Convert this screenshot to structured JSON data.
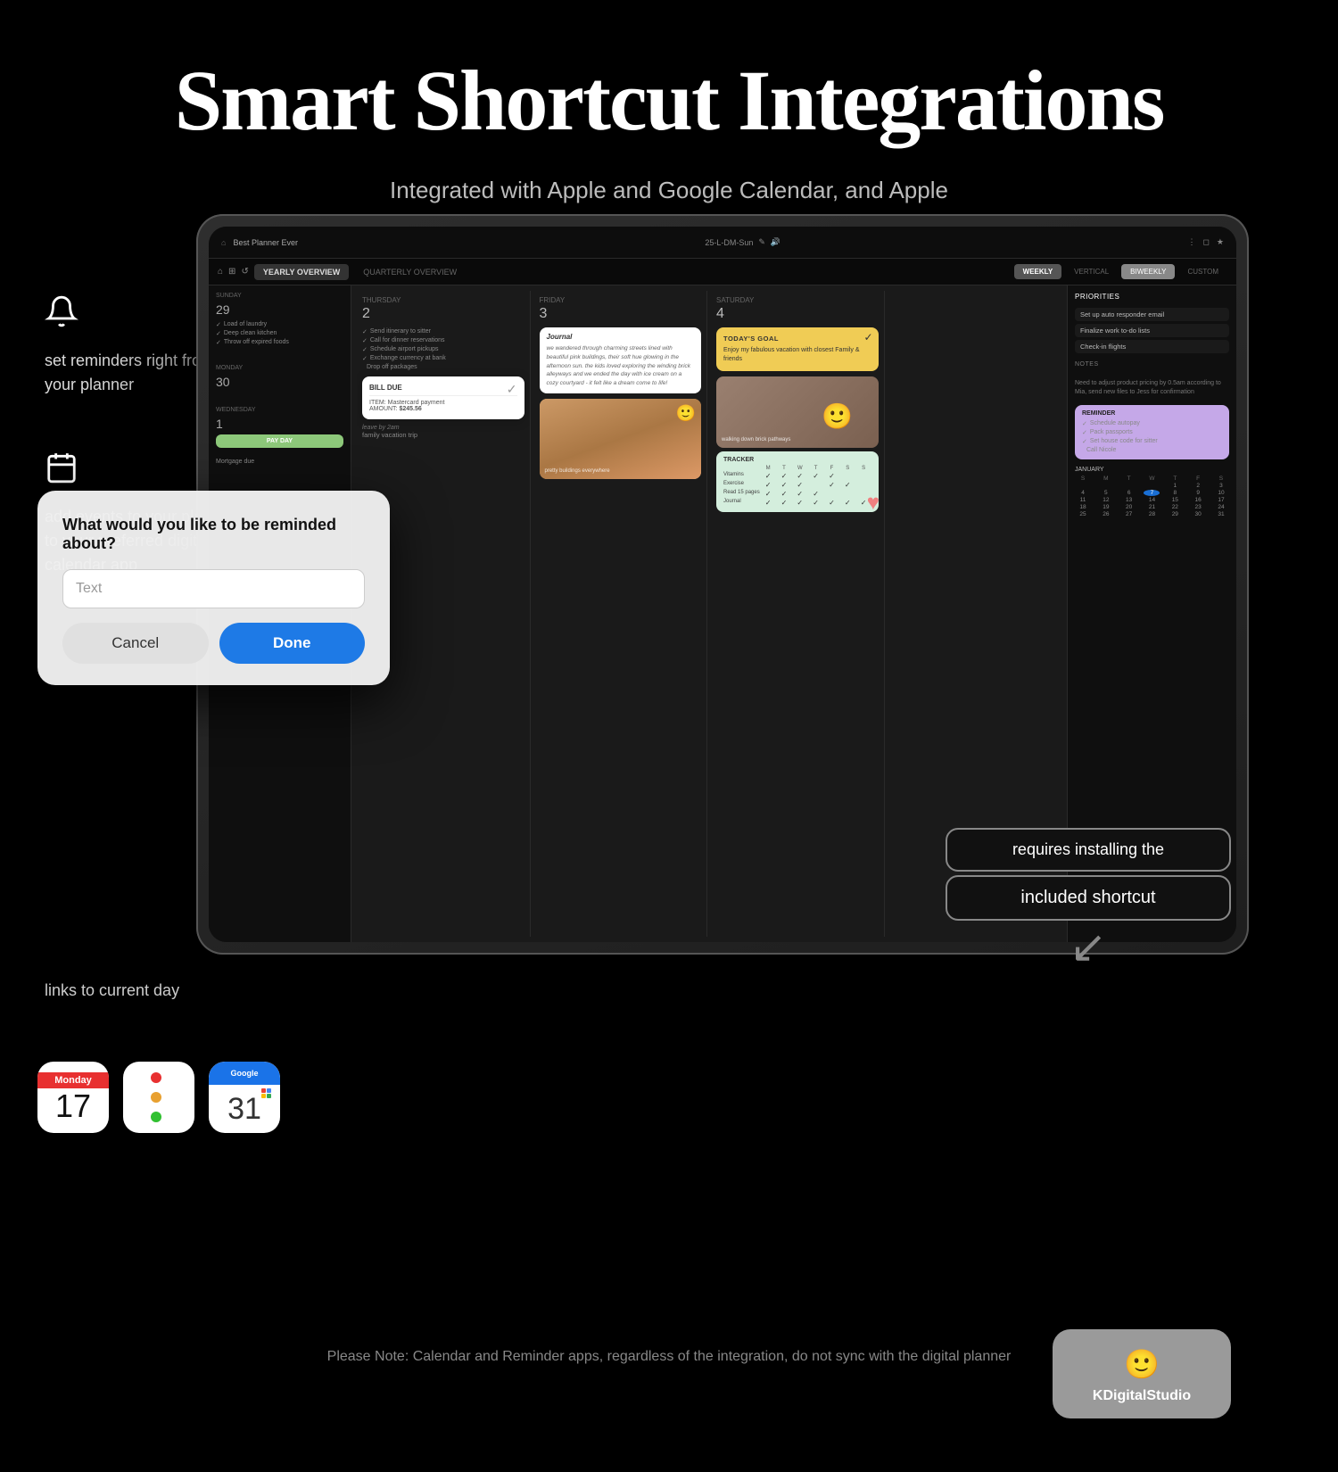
{
  "page": {
    "title": "Smart Shortcut Integrations",
    "subtitle": "Integrated with Apple and Google Calendar, and Apple Reminders\nusing Shortcuts on iPad"
  },
  "features": [
    {
      "id": "reminders",
      "icon": "bell",
      "text": "set reminders right from your planner"
    },
    {
      "id": "calendar",
      "icon": "calendar",
      "text": "add events to your planner to your preferred digital calendar app"
    },
    {
      "id": "today",
      "icon": "link",
      "text": "links to current day"
    }
  ],
  "dialog": {
    "title": "What would you like to be reminded about?",
    "placeholder": "Text",
    "cancel_label": "Cancel",
    "done_label": "Done"
  },
  "planner": {
    "nav_tabs": [
      "YEARLY OVERVIEW",
      "QUARTERLY OVERVIEW"
    ],
    "view_tabs": [
      "WEEKLY",
      "VERTICAL",
      "BIWEEKLY",
      "CUSTOM"
    ],
    "top_bar_left": "Best Planner Ever",
    "top_bar_date": "25-L-DM-Sun",
    "days": [
      {
        "label": "SUNDAY",
        "num": "29",
        "tasks": [
          "Load of laundry",
          "Deep clean kitchen",
          "Throw off expired foods"
        ]
      },
      {
        "label": "THURSDAY",
        "num": "2",
        "tasks": [
          "Send itinerary to sitter",
          "Call for dinner reservations",
          "Schedule airport pickups",
          "Exchange currency at bank",
          "Drop off packages"
        ]
      },
      {
        "label": "FRIDAY",
        "num": "3",
        "tasks": []
      },
      {
        "label": "SATURDAY",
        "num": "4",
        "tasks": []
      }
    ],
    "priorities": [
      "Set up auto responder email",
      "Finalize work to-do lists",
      "Check-in flights"
    ],
    "notes": "Need to adjust product pricing by 0.5am according to Mia, send new files to Jess for confirmation",
    "reminder_card": [
      "Schedule autopay",
      "Pack passports",
      "Set house code for sitter",
      "Call Nicole"
    ],
    "bill": {
      "title": "BILL DUE",
      "item": "Mastercard payment",
      "amount": "$245.56"
    },
    "journal_text": "we wandered through charming streets lined with beautiful pink buildings, their soft hue glowing in the afternoon sun. the kids loved exploring the winding brick alleyways and we ended the day with ice cream on a cozy courtyard - it felt like a dream come to life!",
    "today_goal": "Enjoy my fabulous vacation with closest Family & friends",
    "tracker": {
      "title": "TRACKER",
      "items": [
        "Vitamins",
        "Exercise",
        "Read 15 pages",
        "Journal"
      ],
      "days_short": [
        "M",
        "T",
        "W",
        "T",
        "F",
        "S",
        "S"
      ]
    }
  },
  "callout": {
    "line1": "requires installing the",
    "line2": "included shortcut"
  },
  "app_icons": [
    {
      "id": "apple-calendar",
      "label": "Monday",
      "num": "17"
    },
    {
      "id": "reminders",
      "label": "Reminders"
    },
    {
      "id": "google-calendar",
      "label": "Google Calendar",
      "num": "31"
    }
  ],
  "bottom_note": "Please Note: Calendar and Reminder apps, regardless of the integration, do not sync with the digital planner",
  "studio": {
    "name": "KDigitalStudio"
  },
  "colors": {
    "background": "#000000",
    "accent_blue": "#1e7ae6",
    "card_yellow": "#f0cc55",
    "card_green": "#c5e8d4",
    "card_purple": "#c5a8e8",
    "title_white": "#ffffff"
  }
}
